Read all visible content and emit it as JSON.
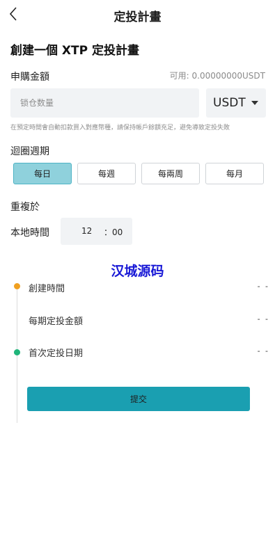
{
  "header": {
    "title": "定投計畫",
    "back_icon": "chevron-left-icon"
  },
  "plan_title": "創建一個 XTP 定投計畫",
  "amount": {
    "label": "申購金額",
    "available": "可用: 0.00000000USDT",
    "placeholder": "锁仓数量",
    "currency": "USDT",
    "hint": "在預定時間會自動扣款買入對應幣種，請保持帳戶餘額充足，避免導致定投失敗"
  },
  "cycle": {
    "label": "迴圈週期",
    "options": [
      "每日",
      "每週",
      "每兩周",
      "每月"
    ],
    "selected": "每日"
  },
  "repeat": {
    "label": "重複於",
    "time_label": "本地時間",
    "hour": "12",
    "minute": "：00"
  },
  "watermark": "汉城源码",
  "timeline": [
    {
      "label": "創建時間",
      "value": "- -",
      "dot_color": "#f0a020"
    },
    {
      "label": "每期定投金額",
      "value": "- -",
      "dot_color": ""
    },
    {
      "label": "首次定投日期",
      "value": "- -",
      "dot_color": "#1fb57a"
    }
  ],
  "submit_label": "提交",
  "colors": {
    "accent": "#1a9fb1",
    "selected_chip": "#8fd1dc",
    "watermark": "#1818d6"
  }
}
